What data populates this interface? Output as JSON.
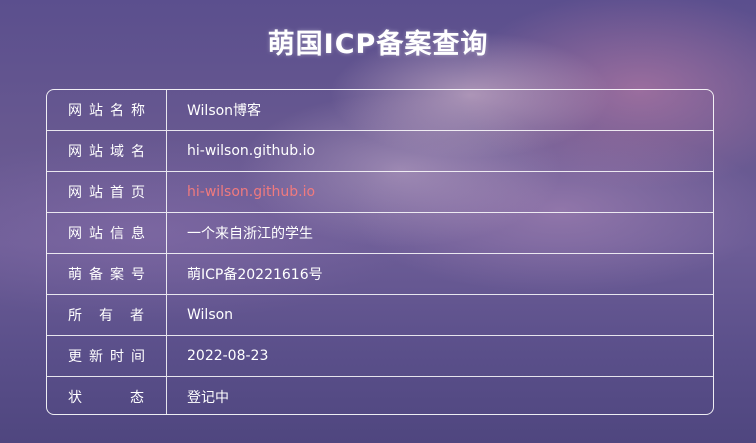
{
  "page": {
    "title": "萌国ICP备案查询"
  },
  "rows": [
    {
      "label": "网站名称",
      "value": "Wilson博客"
    },
    {
      "label": "网站域名",
      "value": "hi-wilson.github.io"
    },
    {
      "label": "网站首页",
      "value": "hi-wilson.github.io"
    },
    {
      "label": "网站信息",
      "value": "一个来自浙江的学生"
    },
    {
      "label": "萌备案号",
      "value": "萌ICP备20221616号"
    },
    {
      "label_chars": [
        "所",
        "有",
        "者"
      ],
      "value": "Wilson"
    },
    {
      "label": "更新时间",
      "value": "2022-08-23"
    },
    {
      "label_chars": [
        "状",
        "态"
      ],
      "value": "登记中"
    }
  ],
  "colors": {
    "link": "#f07a7e",
    "text": "#ffffff",
    "border": "#ffffff"
  }
}
